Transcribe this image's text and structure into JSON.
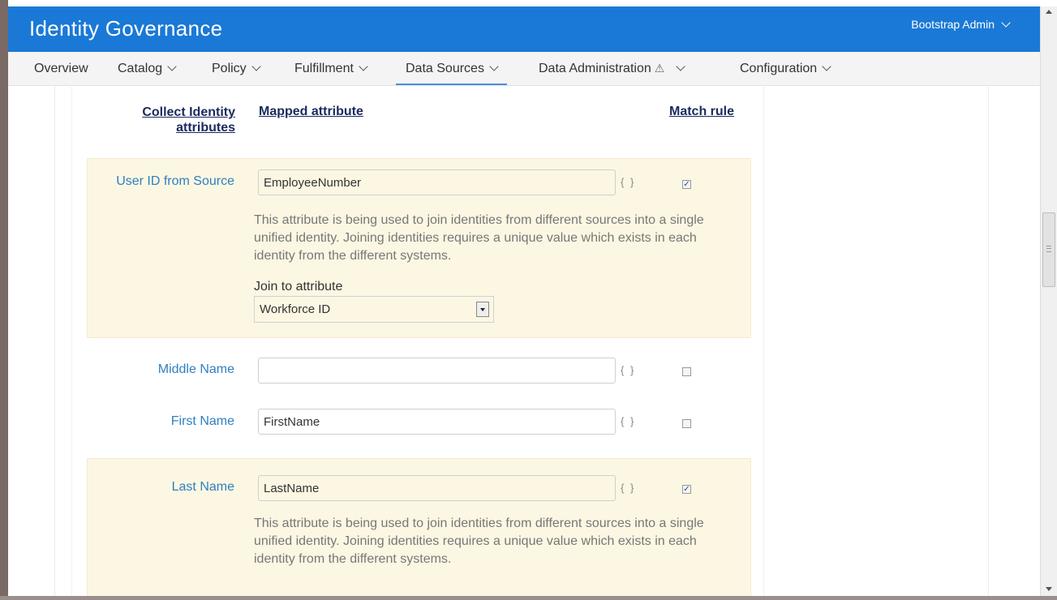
{
  "header": {
    "title": "Identity Governance",
    "user_menu_label": "Bootstrap Admin"
  },
  "nav": {
    "items": [
      {
        "label": "Overview",
        "has_dropdown": false
      },
      {
        "label": "Catalog",
        "has_dropdown": true
      },
      {
        "label": "Policy",
        "has_dropdown": true
      },
      {
        "label": "Fulfillment",
        "has_dropdown": true
      },
      {
        "label": "Data Sources",
        "has_dropdown": true,
        "active": true
      },
      {
        "label": "Data Administration",
        "has_dropdown": true,
        "icon": "warning-icon"
      },
      {
        "label": "Configuration",
        "has_dropdown": true
      }
    ]
  },
  "table": {
    "col_collect_line1": "Collect Identity",
    "col_collect_line2": "attributes",
    "col_mapped": "Mapped attribute",
    "col_match": "Match rule",
    "braces_symbol": "{ }",
    "rows": [
      {
        "label": "User ID from Source",
        "value": "EmployeeNumber",
        "checked": true,
        "help": "This attribute is being used to join identities from different sources into a single unified identity. Joining identities requires a unique value which exists in each identity from the different systems.",
        "join_label": "Join to attribute",
        "join_value": "Workforce ID"
      },
      {
        "label": "Middle Name",
        "value": "",
        "checked": false
      },
      {
        "label": "First Name",
        "value": "FirstName",
        "checked": false
      },
      {
        "label": "Last Name",
        "value": "LastName",
        "checked": true,
        "help": "This attribute is being used to join identities from different sources into a single unified identity. Joining identities requires a unique value which exists in each identity from the different systems."
      }
    ]
  },
  "checkmark_glyph": "✓",
  "colors": {
    "header_bg": "#1a79d6",
    "label_blue": "#2f7fc1",
    "panel_bg": "#fcf7e3",
    "heading_navy": "#1a2a5e"
  }
}
